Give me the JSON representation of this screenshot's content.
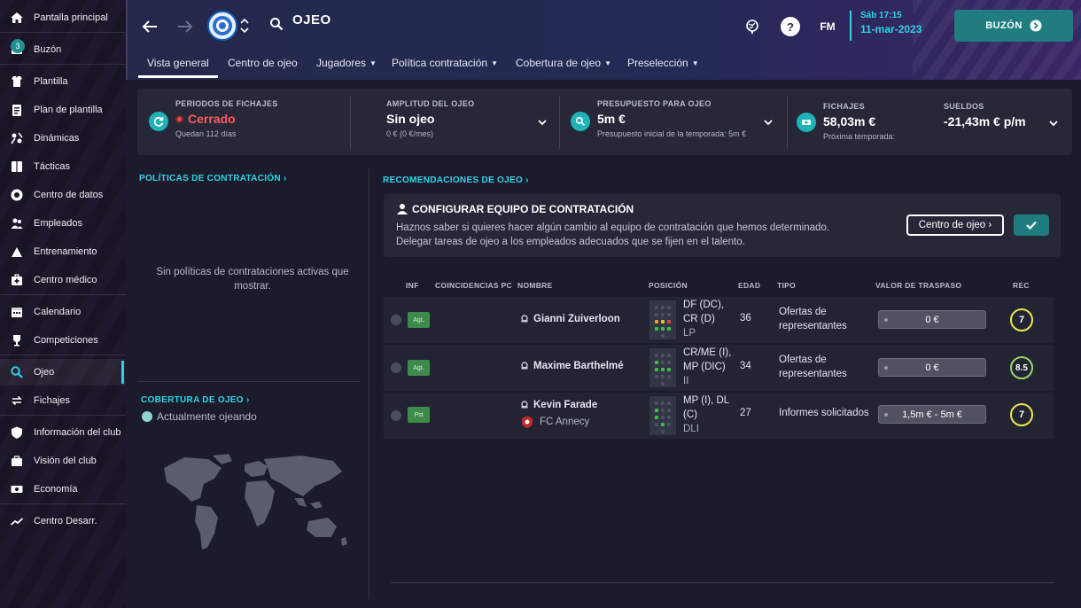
{
  "sidebar": {
    "items": [
      {
        "label": "Pantalla principal",
        "icon": "home-icon"
      },
      {
        "label": "Buzón",
        "icon": "inbox-icon",
        "badge": "3"
      },
      {
        "label": "Plantilla",
        "icon": "squad-icon"
      },
      {
        "label": "Plan de plantilla",
        "icon": "clipboard-icon"
      },
      {
        "label": "Dinámicas",
        "icon": "dynamics-icon"
      },
      {
        "label": "Tácticas",
        "icon": "tactics-icon"
      },
      {
        "label": "Centro de datos",
        "icon": "data-icon"
      },
      {
        "label": "Empleados",
        "icon": "staff-icon"
      },
      {
        "label": "Entrenamiento",
        "icon": "training-icon"
      },
      {
        "label": "Centro médico",
        "icon": "medical-icon"
      },
      {
        "label": "Calendario",
        "icon": "calendar-icon"
      },
      {
        "label": "Competiciones",
        "icon": "trophy-icon"
      },
      {
        "label": "Ojeo",
        "icon": "scouting-icon",
        "active": true
      },
      {
        "label": "Fichajes",
        "icon": "transfers-icon"
      },
      {
        "label": "Información del club",
        "icon": "club-info-icon"
      },
      {
        "label": "Visión del club",
        "icon": "club-vision-icon"
      },
      {
        "label": "Economía",
        "icon": "finances-icon"
      },
      {
        "label": "Centro Desarr.",
        "icon": "development-icon"
      }
    ]
  },
  "header": {
    "title": "OJEO",
    "fm_label": "FM",
    "date_line1": "Sáb 17:15",
    "date_line2": "11-mar-2023",
    "inbox_button": "BUZÓN",
    "tabs": [
      {
        "label": "Vista general",
        "active": true,
        "dropdown": false
      },
      {
        "label": "Centro de ojeo",
        "dropdown": false
      },
      {
        "label": "Jugadores",
        "dropdown": true
      },
      {
        "label": "Política contratación",
        "dropdown": true
      },
      {
        "label": "Cobertura de ojeo",
        "dropdown": true
      },
      {
        "label": "Preselección",
        "dropdown": true
      }
    ]
  },
  "summary": {
    "periods": {
      "label": "PERIODOS DE FICHAJES",
      "value": "Cerrado",
      "sub": "Quedan 112 días"
    },
    "breadth": {
      "label": "AMPLITUD DEL OJEO",
      "value": "Sin ojeo",
      "sub": "0 € (0 €/mes)"
    },
    "budget": {
      "label": "PRESUPUESTO PARA OJEO",
      "value": "5m €",
      "sub": "Presupuesto inicial de la temporada: 5m €"
    },
    "transfers": {
      "label": "FICHAJES",
      "value": "58,03m €",
      "sub": "Próxima temporada:"
    },
    "wages": {
      "label": "SUELDOS",
      "value": "-21,43m € p/m"
    }
  },
  "left": {
    "policies_title": "POLÍTICAS DE CONTRATACIÓN",
    "policies_empty": "Sin políticas de contrataciones activas que mostrar.",
    "coverage_title": "COBERTURA DE OJEO",
    "coverage_status": "Actualmente ojeando"
  },
  "recommendations": {
    "title": "RECOMENDACIONES DE OJEO",
    "config_title": "CONFIGURAR EQUIPO DE CONTRATACIÓN",
    "config_desc": "Haznos saber si quieres hacer algún cambio al equipo de contratación que hemos determinado. Delegar tareas de ojeo a los empleados adecuados que se fijen en el talento.",
    "config_button": "Centro de ojeo",
    "columns": [
      "INF",
      "COINCIDENCIAS PC",
      "NOMBRE",
      "POSICIÓN",
      "EDAD",
      "TIPO",
      "VALOR DE TRASPASO",
      "REC"
    ],
    "rows": [
      {
        "inf": "AgL",
        "name": "Gianni Zuiverloon",
        "club": "",
        "pos1": "DF (DC),",
        "pos2": "CR (D)",
        "pos3": "LP",
        "age": "36",
        "type1": "Ofertas de",
        "type2": "representantes",
        "value": "0 €",
        "rec": "7"
      },
      {
        "inf": "AgL",
        "name": "Maxime Barthelmé",
        "club": "",
        "pos1": "CR/ME (I),",
        "pos2": "MP (DIC)",
        "pos3": "II",
        "age": "34",
        "type1": "Ofertas de",
        "type2": "representantes",
        "value": "0 €",
        "rec": "8.5"
      },
      {
        "inf": "Pst",
        "name": "Kevin Farade",
        "club": "FC Annecy",
        "pos1": "MP (I), DL",
        "pos2": "(C)",
        "pos3": "DLI",
        "age": "27",
        "type1": "Informes solicitados",
        "type2": "",
        "value": "1,5m € - 5m €",
        "rec": "7"
      }
    ]
  },
  "colors": {
    "accent": "#2fd3e8",
    "closed": "#ff5a5a",
    "teal_button": "#1f7d80",
    "rec_yellow": "#f0e44a",
    "rec_green": "#9ed36a"
  }
}
